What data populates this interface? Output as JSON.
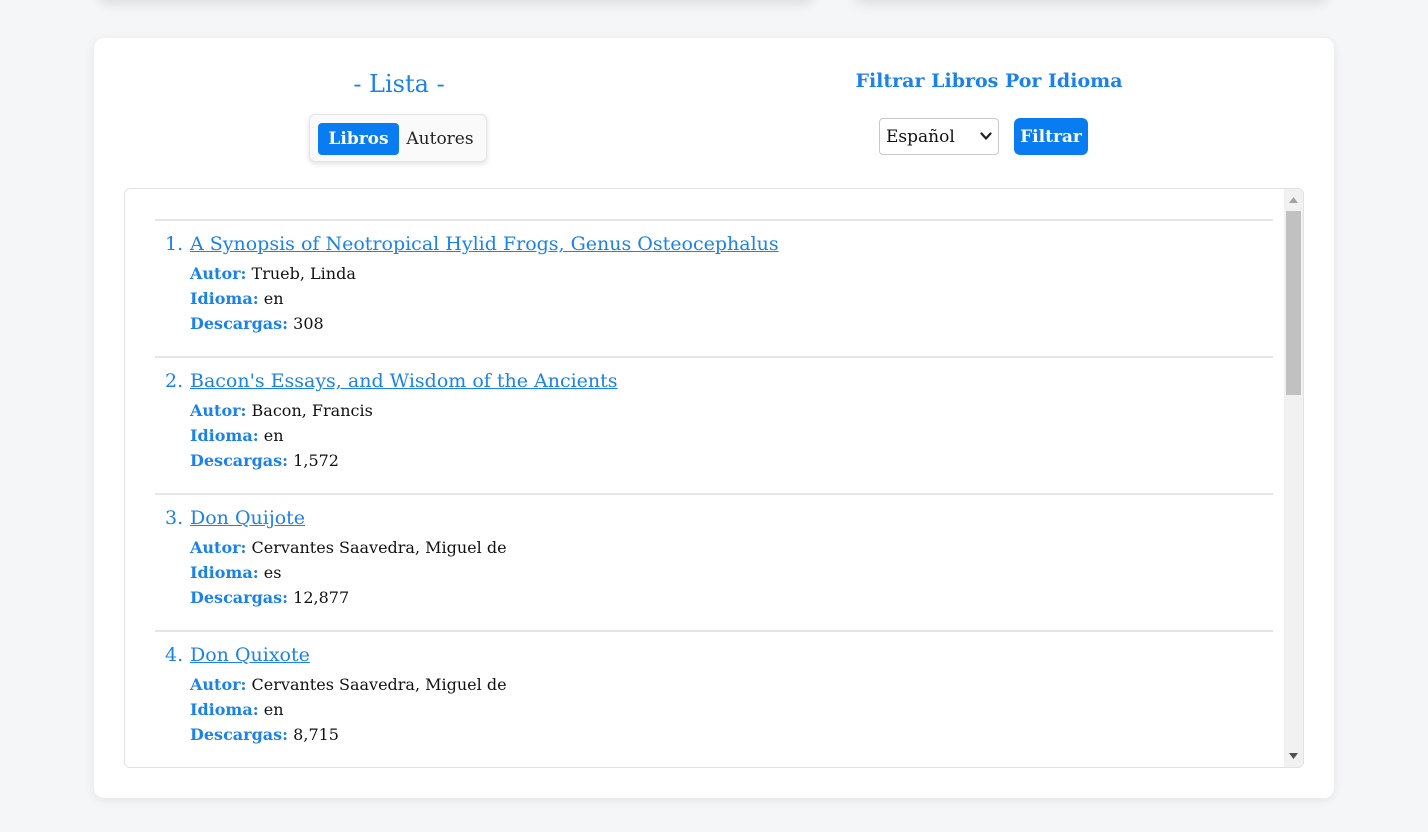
{
  "lista": {
    "title": "- Lista -",
    "tabs": [
      {
        "label": "Libros",
        "active": true
      },
      {
        "label": "Autores",
        "active": false
      }
    ]
  },
  "filter": {
    "title": "Filtrar Libros Por Idioma",
    "selected_language": "Español",
    "button_label": "Filtrar"
  },
  "labels": {
    "author": "Autor:",
    "language": "Idioma:",
    "downloads": "Descargas:"
  },
  "books": [
    {
      "number": "1.",
      "title": "A Synopsis of Neotropical Hylid Frogs, Genus Osteocephalus",
      "author": "Trueb, Linda",
      "language": "en",
      "downloads": "308"
    },
    {
      "number": "2.",
      "title": "Bacon's Essays, and Wisdom of the Ancients",
      "author": "Bacon, Francis",
      "language": "en",
      "downloads": "1,572"
    },
    {
      "number": "3.",
      "title": "Don Quijote",
      "author": "Cervantes Saavedra, Miguel de",
      "language": "es",
      "downloads": "12,877"
    },
    {
      "number": "4.",
      "title": "Don Quixote",
      "author": "Cervantes Saavedra, Miguel de",
      "language": "en",
      "downloads": "8,715"
    }
  ],
  "colors": {
    "accent": "#1a82e8",
    "button": "#0a7cf2"
  }
}
